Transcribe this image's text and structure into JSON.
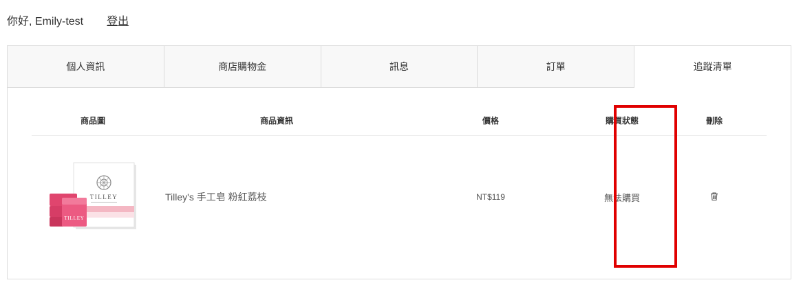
{
  "header": {
    "greeting": "你好, Emily-test",
    "logout_label": "登出"
  },
  "tabs": [
    {
      "label": "個人資訊",
      "active": false
    },
    {
      "label": "商店購物金",
      "active": false
    },
    {
      "label": "訊息",
      "active": false
    },
    {
      "label": "訂單",
      "active": false
    },
    {
      "label": "追蹤清單",
      "active": true
    }
  ],
  "wishlist": {
    "columns": [
      "商品圖",
      "商品資訊",
      "價格",
      "購買狀態",
      "刪除"
    ],
    "rows": [
      {
        "product_name": "Tilley's 手工皂 粉紅荔枝",
        "price": "NT$119",
        "status": "無法購買",
        "image": {
          "brand": "TILLEY",
          "description": "Tilley soap box with pink soap bars"
        }
      }
    ]
  },
  "annotation": {
    "highlight_color": "#e00000"
  },
  "icons": {
    "delete": "trash-icon"
  }
}
